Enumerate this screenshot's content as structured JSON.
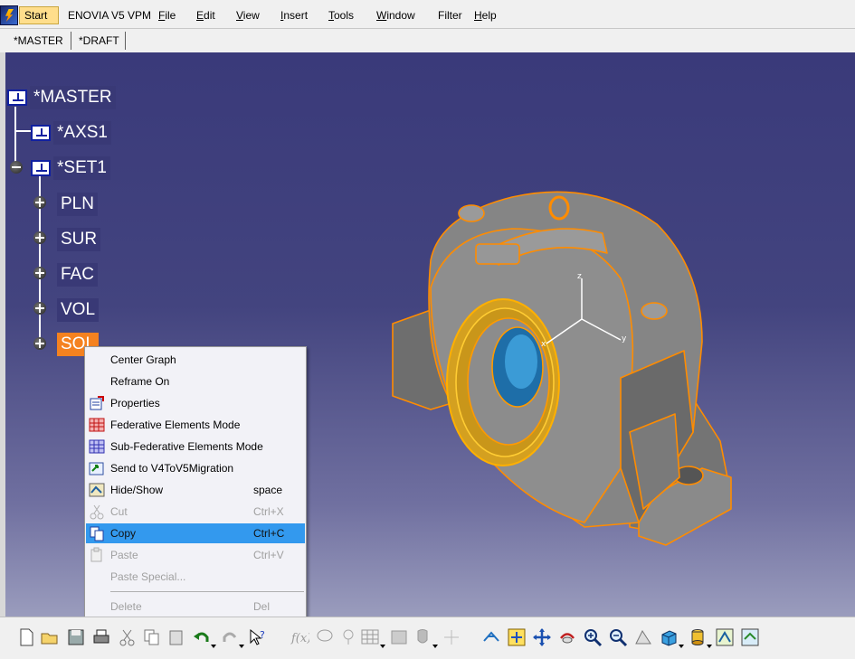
{
  "menubar": {
    "start": "Start",
    "app": "ENOVIA V5 VPM",
    "items": [
      {
        "label": "File",
        "u": "F",
        "rest": "ile"
      },
      {
        "label": "Edit",
        "u": "E",
        "rest": "dit"
      },
      {
        "label": "View",
        "u": "V",
        "rest": "iew"
      },
      {
        "label": "Insert",
        "u": "I",
        "rest": "nsert"
      },
      {
        "label": "Tools",
        "u": "T",
        "rest": "ools"
      },
      {
        "label": "Window",
        "u": "W",
        "rest": "indow"
      },
      {
        "label": "Filter",
        "u": "",
        "rest": "Filter"
      },
      {
        "label": "Help",
        "u": "H",
        "rest": "elp"
      }
    ]
  },
  "tabs": [
    "*MASTER",
    "*DRAFT"
  ],
  "tree": {
    "root": "*MASTER",
    "axis": "*AXS1",
    "set": "*SET1",
    "children": [
      "PLN",
      "SUR",
      "FAC",
      "VOL",
      "SOL"
    ]
  },
  "context_menu": {
    "items": [
      {
        "label": "Center Graph",
        "shortcut": "",
        "icon": "",
        "disabled": false
      },
      {
        "label": "Reframe On",
        "shortcut": "",
        "icon": "",
        "disabled": false
      },
      {
        "label": "Properties",
        "shortcut": "",
        "icon": "properties-icon",
        "disabled": false
      },
      {
        "label": "Federative Elements Mode",
        "shortcut": "",
        "icon": "federative-grid-icon",
        "disabled": false
      },
      {
        "label": "Sub-Federative Elements Mode",
        "shortcut": "",
        "icon": "sub-federative-grid-icon",
        "disabled": false
      },
      {
        "label": "Send to V4ToV5Migration",
        "shortcut": "",
        "icon": "send-to-icon",
        "disabled": false
      },
      {
        "label": "Hide/Show",
        "shortcut": "space",
        "icon": "hide-show-icon",
        "disabled": false
      },
      {
        "label": "Cut",
        "shortcut": "Ctrl+X",
        "icon": "scissors-icon",
        "disabled": true
      },
      {
        "label": "Copy",
        "shortcut": "Ctrl+C",
        "icon": "copy-icon",
        "disabled": false,
        "highlighted": true
      },
      {
        "label": "Paste",
        "shortcut": "Ctrl+V",
        "icon": "paste-icon",
        "disabled": true
      },
      {
        "label": "Paste Special...",
        "shortcut": "",
        "icon": "",
        "disabled": true
      },
      {
        "label": "Delete",
        "shortcut": "Del",
        "icon": "",
        "disabled": true
      }
    ]
  },
  "colors": {
    "selection": "#f58220",
    "menu_highlight": "#3399ee",
    "viewport_top": "#3a3a7a",
    "viewport_bottom": "#9a9cbd",
    "model_edge": "#ff8c00"
  },
  "toolbar_icons": [
    "new-icon",
    "open-icon",
    "save-icon",
    "print-icon",
    "cut-icon",
    "copy-icon",
    "paste-icon",
    "undo-icon",
    "redo-icon",
    "whats-this-icon",
    "formula-icon",
    "comment-icon",
    "knowledge-icon",
    "table-icon",
    "macro-icon",
    "filter-icon",
    "fly-icon",
    "fit-all-icon",
    "pan-icon",
    "rotate-icon",
    "zoom-in-icon",
    "zoom-out-icon",
    "normal-view-icon",
    "iso-view-icon",
    "shading-icon",
    "hide-show-icon",
    "swap-space-icon"
  ]
}
